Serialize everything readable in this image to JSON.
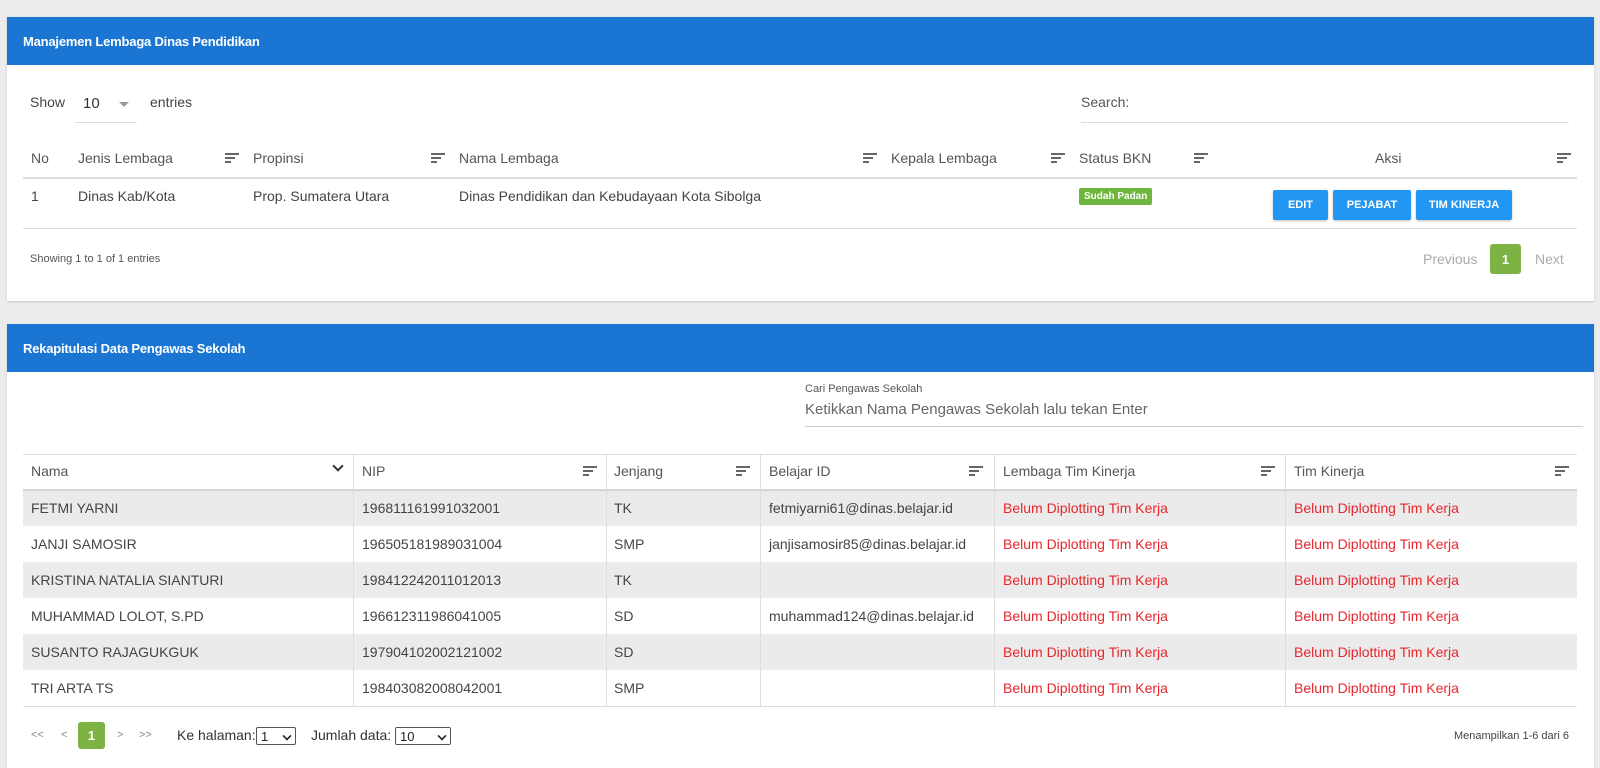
{
  "panel1": {
    "title": "Manajemen Lembaga Dinas Pendidikan",
    "show_label": "Show",
    "entries_value": "10",
    "entries_label": "entries",
    "search_label": "Search:",
    "columns": [
      "No",
      "Jenis Lembaga",
      "Propinsi",
      "Nama Lembaga",
      "Kepala Lembaga",
      "Status BKN",
      "Aksi"
    ],
    "rows": [
      {
        "no": "1",
        "jenis": "Dinas Kab/Kota",
        "propinsi": "Prop. Sumatera Utara",
        "nama": "Dinas Pendidikan dan Kebudayaan Kota Sibolga",
        "kepala": "",
        "status": "Sudah Padan",
        "actions": [
          "EDIT",
          "PEJABAT",
          "TIM KINERJA"
        ]
      }
    ],
    "info": "Showing 1 to 1 of 1 entries",
    "pagination": {
      "previous": "Previous",
      "current": "1",
      "next": "Next"
    }
  },
  "panel2": {
    "title": "Rekapitulasi Data Pengawas Sekolah",
    "search_label": "Cari Pengawas Sekolah",
    "search_placeholder": "Ketikkan Nama Pengawas Sekolah lalu tekan Enter",
    "columns": [
      "Nama",
      "NIP",
      "Jenjang",
      "Belajar ID",
      "Lembaga Tim Kinerja",
      "Tim Kinerja"
    ],
    "rows": [
      {
        "nama": "FETMI YARNI",
        "nip": "196811161991032001",
        "jenjang": "TK",
        "belajar": "fetmiyarni61@dinas.belajar.id",
        "lembaga": "Belum Diplotting Tim Kerja",
        "tim": "Belum Diplotting Tim Kerja"
      },
      {
        "nama": "JANJI SAMOSIR",
        "nip": "196505181989031004",
        "jenjang": "SMP",
        "belajar": "janjisamosir85@dinas.belajar.id",
        "lembaga": "Belum Diplotting Tim Kerja",
        "tim": "Belum Diplotting Tim Kerja"
      },
      {
        "nama": "KRISTINA NATALIA SIANTURI",
        "nip": "198412242011012013",
        "jenjang": "TK",
        "belajar": "",
        "lembaga": "Belum Diplotting Tim Kerja",
        "tim": "Belum Diplotting Tim Kerja"
      },
      {
        "nama": "MUHAMMAD LOLOT, S.PD",
        "nip": "196612311986041005",
        "jenjang": "SD",
        "belajar": "muhammad124@dinas.belajar.id",
        "lembaga": "Belum Diplotting Tim Kerja",
        "tim": "Belum Diplotting Tim Kerja"
      },
      {
        "nama": "SUSANTO RAJAGUKGUK",
        "nip": "197904102002121002",
        "jenjang": "SD",
        "belajar": "",
        "lembaga": "Belum Diplotting Tim Kerja",
        "tim": "Belum Diplotting Tim Kerja"
      },
      {
        "nama": "TRI ARTA TS",
        "nip": "198403082008042001",
        "jenjang": "SMP",
        "belajar": "",
        "lembaga": "Belum Diplotting Tim Kerja",
        "tim": "Belum Diplotting Tim Kerja"
      }
    ],
    "pager": {
      "first": "<<",
      "prev": "<",
      "current": "1",
      "next": ">",
      "last": ">>",
      "page_label": "Ke halaman:",
      "page_value": "1",
      "size_label": "Jumlah data:",
      "size_value": "10"
    },
    "summary": "Menampilkan 1-6 dari 6"
  },
  "colors": {
    "header": "#1a76d2",
    "button": "#2196f3",
    "badge": "#6fb63f",
    "warning_text": "#e8262c"
  }
}
